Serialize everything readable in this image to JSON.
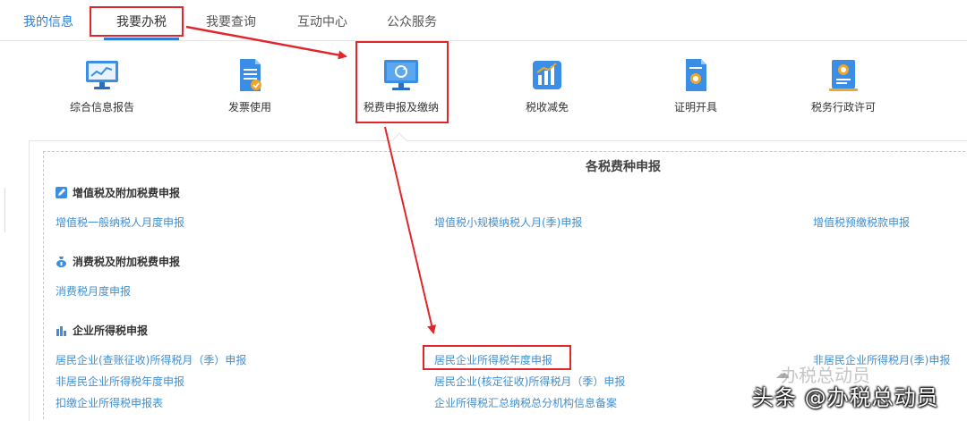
{
  "nav": {
    "tabs": [
      {
        "label": "我的信息"
      },
      {
        "label": "我要办税"
      },
      {
        "label": "我要查询"
      },
      {
        "label": "互动中心"
      },
      {
        "label": "公众服务"
      }
    ]
  },
  "functions": [
    {
      "label": "综合信息报告",
      "icon": "monitor-chart-icon"
    },
    {
      "label": "发票使用",
      "icon": "invoice-document-icon"
    },
    {
      "label": "税费申报及缴纳",
      "icon": "monitor-refresh-icon"
    },
    {
      "label": "税收减免",
      "icon": "bar-chart-icon"
    },
    {
      "label": "证明开具",
      "icon": "certificate-document-icon"
    },
    {
      "label": "税务行政许可",
      "icon": "license-badge-icon"
    }
  ],
  "panel": {
    "title": "各税费种申报",
    "sections": [
      {
        "title": "增值税及附加税费申报",
        "icon": "edit-square-icon",
        "links": [
          "增值税一般纳税人月度申报",
          "增值税小规模纳税人月(季)申报",
          "增值税预缴税款申报"
        ]
      },
      {
        "title": "消费税及附加税费申报",
        "icon": "money-bag-icon",
        "links": [
          "消费税月度申报"
        ]
      },
      {
        "title": "企业所得税申报",
        "icon": "building-chart-icon",
        "links": [
          "居民企业(查账征收)所得税月（季）申报",
          "居民企业所得税年度申报",
          "非居民企业所得税月(季)申报",
          "非居民企业所得税年度申报",
          "居民企业(核定征收)所得税月（季）申报",
          "扣缴企业所得税申报表",
          "企业所得税汇总纳税总分机构信息备案"
        ]
      }
    ]
  },
  "watermark": {
    "text": "头条 @办税总动员",
    "faint_text": "办税总动员"
  },
  "colors": {
    "accent_blue": "#2b7fd8",
    "link_blue": "#3f8fd2",
    "highlight_red": "#e0262b"
  }
}
